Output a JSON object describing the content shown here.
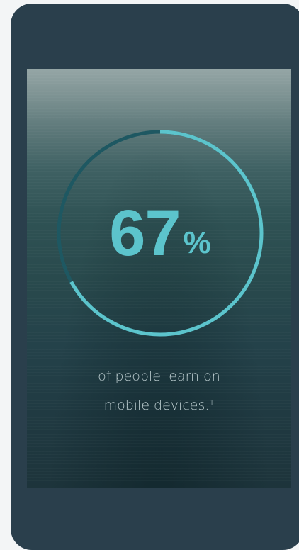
{
  "stat": {
    "value": "67",
    "unit": "%",
    "progress_fraction": 0.67
  },
  "caption": {
    "line1": "of people learn on",
    "line2": "mobile devices.",
    "footnote": "1"
  },
  "colors": {
    "phone_frame": "#2a3f4c",
    "ring_progress": "#5cc4cc",
    "ring_track": "#1e5862",
    "stat_text": "#5cc4cc",
    "caption_text": "#b9cacd"
  }
}
